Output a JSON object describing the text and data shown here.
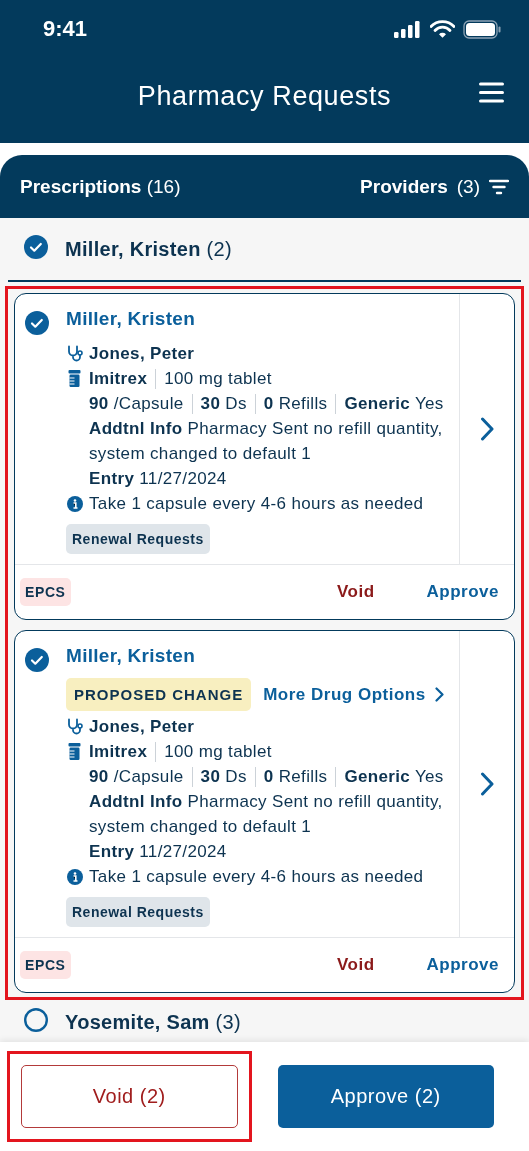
{
  "status_bar": {
    "time": "9:41"
  },
  "header": {
    "title": "Pharmacy Requests"
  },
  "list_bar": {
    "title": "Prescriptions",
    "count": "(16)",
    "filter_label": "Providers",
    "filter_count": "(3)"
  },
  "groups": [
    {
      "patient": "Miller, Kristen",
      "count": "(2)",
      "checked": true,
      "highlighted": true,
      "requests": [
        {
          "patient": "Miller, Kristen",
          "checked": true,
          "prescriber": "Jones, Peter",
          "drug": "Imitrex",
          "strength": "100 mg tablet",
          "quantity": "**90** /Capsule",
          "days": "**30** Ds",
          "refills": "**0** Refills",
          "generic": "**Generic** Yes",
          "info": "**Addtnl Info** Pharmacy Sent no refill quantity, system changed to default 1",
          "entry": "**Entry** 11/27/2024",
          "sig": "Take 1 capsule every 4-6 hours as needed",
          "tag": "Renewal Requests",
          "badge": "EPCS",
          "void": "Void",
          "approve": "Approve"
        },
        {
          "patient": "Miller, Kristen",
          "checked": true,
          "proposed_change": "PROPOSED CHANGE",
          "more_options": "More Drug Options",
          "prescriber": "Jones, Peter",
          "drug": "Imitrex",
          "strength": "100 mg tablet",
          "quantity": "**90** /Capsule",
          "days": "**30** Ds",
          "refills": "**0** Refills",
          "generic": "**Generic** Yes",
          "info": "**Addtnl Info** Pharmacy Sent no refill quantity, system changed to default 1",
          "entry": "**Entry** 11/27/2024",
          "sig": "Take 1 capsule every 4-6 hours as needed",
          "tag": "Renewal Requests",
          "badge": "EPCS",
          "void": "Void",
          "approve": "Approve"
        }
      ]
    },
    {
      "patient": "Yosemite, Sam",
      "count": "(3)",
      "checked": false
    }
  ],
  "footer": {
    "void": {
      "label": "Void (2)",
      "highlighted": true
    },
    "approve": {
      "label": "Approve (2)"
    }
  }
}
